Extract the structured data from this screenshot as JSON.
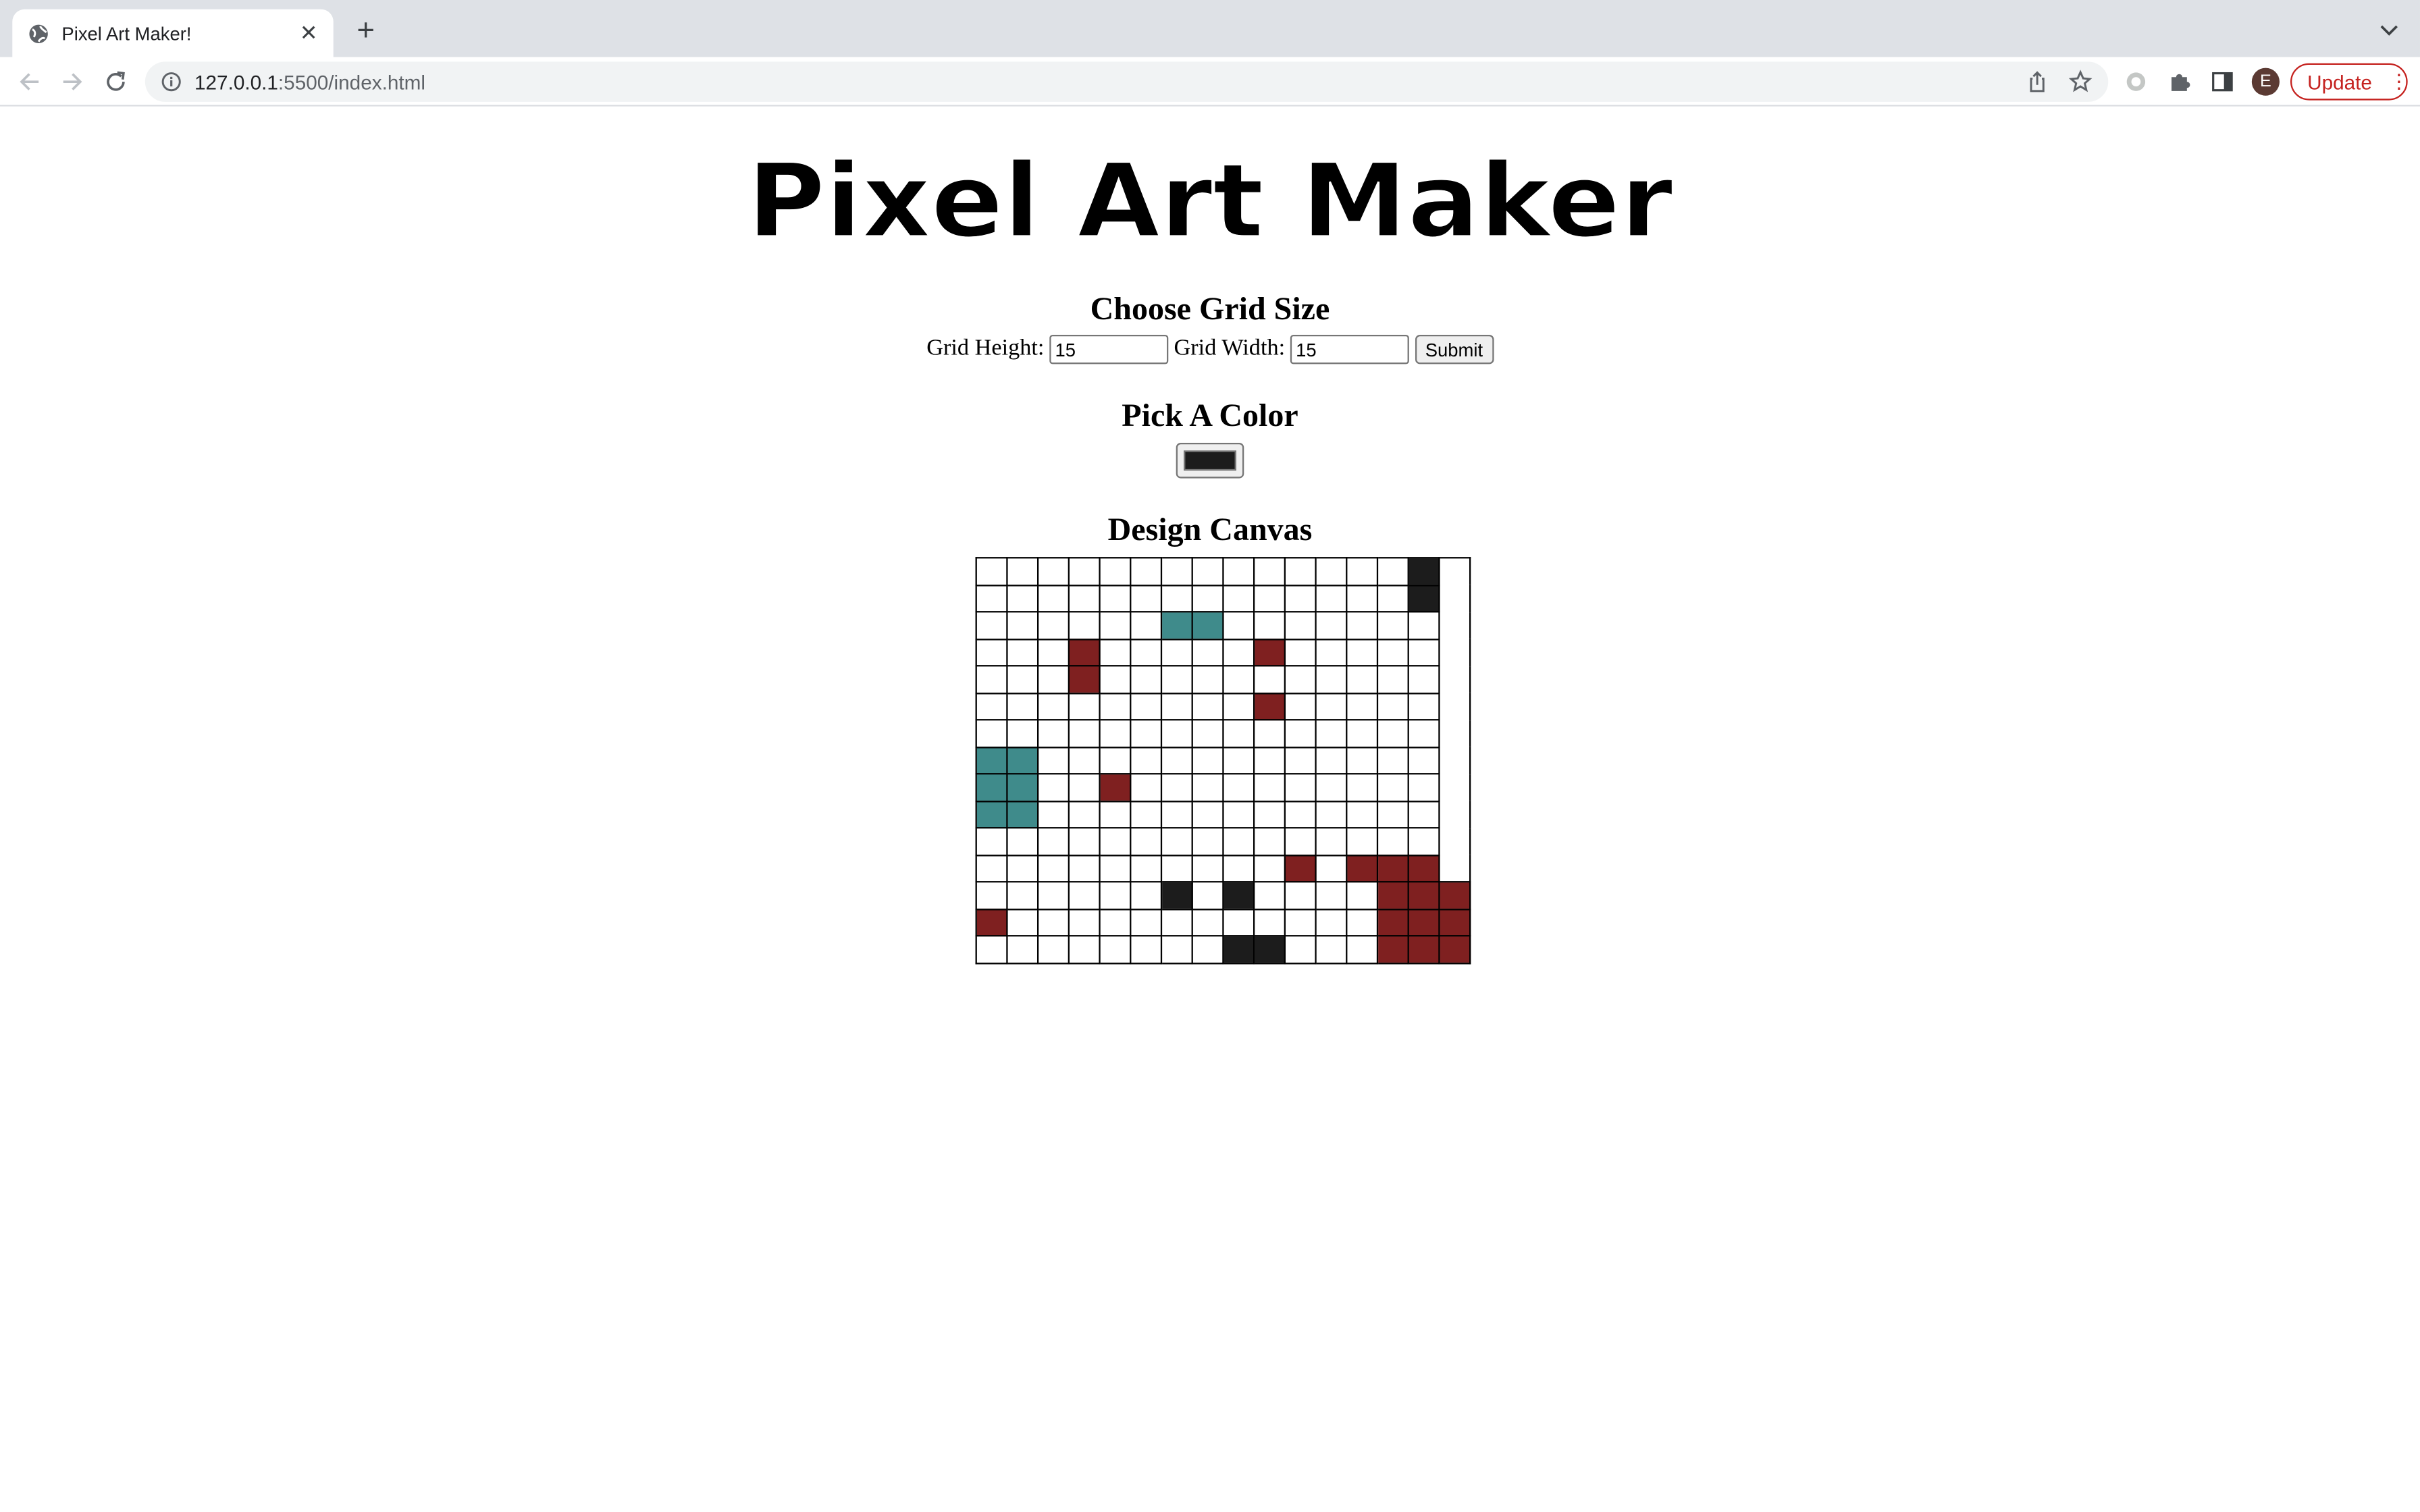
{
  "browser": {
    "tab_title": "Pixel Art Maker!",
    "new_tab": "+",
    "url_host": "127.0.0.1",
    "url_rest": ":5500/index.html",
    "avatar_letter": "E",
    "update_label": "Update"
  },
  "page": {
    "logo_text": "Pixel Art Maker",
    "grid_section": {
      "heading": "Choose Grid Size",
      "height_label": "Grid Height:",
      "height_value": "15",
      "width_label": "Grid Width:",
      "width_value": "15",
      "submit_label": "Submit"
    },
    "color_section": {
      "heading": "Pick A Color",
      "selected_color": "#1c1c1c"
    },
    "canvas_section": {
      "heading": "Design Canvas",
      "rows": 15,
      "cols": 15,
      "palette": {
        "K": "#1c1c1c",
        "R": "#7f2020",
        "T": "#3f8b8b",
        ".": "#ffffff"
      },
      "pixels": [
        "..............K",
        "..............K",
        "......TT.......",
        "...R.....R.....",
        "...R...........",
        ".........R.....",
        "...............",
        "TT.............",
        "TT..R..........",
        "TT.............",
        "...............",
        "..........R.RRR",
        "......K.K....RRR",
        "R............RRR",
        "........KK...RRR"
      ]
    }
  }
}
